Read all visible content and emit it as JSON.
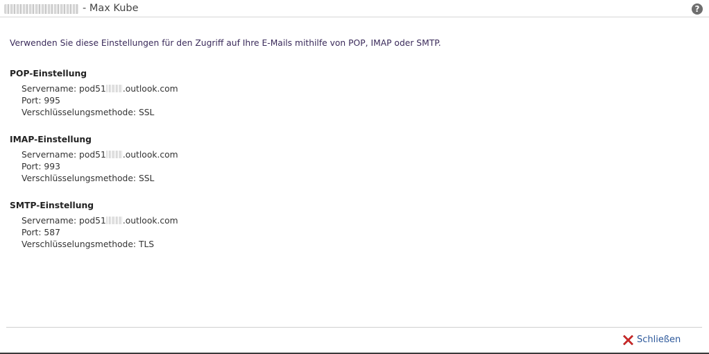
{
  "titlebar": {
    "title": "- Max Kube",
    "help_glyph": "?"
  },
  "intro": "Verwenden Sie diese Einstellungen für den Zugriff auf Ihre E-Mails mithilfe von POP, IMAP oder SMTP.",
  "pop": {
    "heading": "POP-Einstellung",
    "server_prefix": "Servername: pod51",
    "server_suffix": ".outlook.com",
    "port": "Port: 995",
    "encryption": "Verschlüsselungsmethode: SSL"
  },
  "imap": {
    "heading": "IMAP-Einstellung",
    "server_prefix": "Servername: pod51",
    "server_suffix": ".outlook.com",
    "port": "Port: 993",
    "encryption": "Verschlüsselungsmethode: SSL"
  },
  "smtp": {
    "heading": "SMTP-Einstellung",
    "server_prefix": "Servername: pod51",
    "server_suffix": ".outlook.com",
    "port": "Port: 587",
    "encryption": "Verschlüsselungsmethode: TLS"
  },
  "footer": {
    "close_label": "Schließen"
  },
  "icons": {
    "help": "help-icon",
    "close": "close-x-icon"
  },
  "colors": {
    "close_icon": "#d42a2a",
    "link": "#2b579a",
    "intro_text": "#3a2a5a"
  }
}
